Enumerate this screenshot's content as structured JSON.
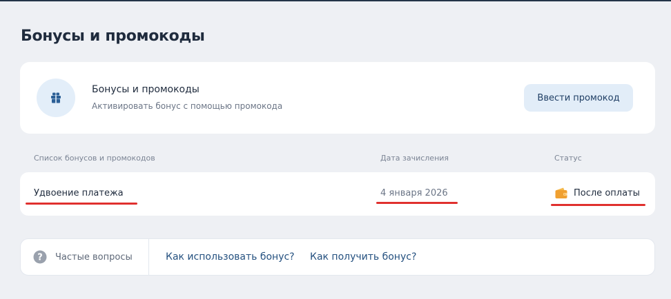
{
  "page": {
    "title": "Бонусы и промокоды"
  },
  "promo_card": {
    "title": "Бонусы и промокоды",
    "subtitle": "Активировать бонус с помощью промокода",
    "button_label": "Ввести промокод",
    "icon": "gift-icon"
  },
  "table": {
    "headers": {
      "name": "Список бонусов и промокодов",
      "date": "Дата зачисления",
      "status": "Статус"
    },
    "rows": [
      {
        "name": "Удвоение платежа",
        "date": "4 января 2026",
        "status": "После оплаты",
        "status_icon": "wallet-icon"
      }
    ]
  },
  "faq": {
    "label": "Частые вопросы",
    "icon": "question-icon",
    "links": [
      "Как использовать бонус?",
      "Как получить бонус?"
    ]
  },
  "colors": {
    "background": "#eef0f4",
    "accent_button": "#e2edf8",
    "link": "#24507f",
    "annotation_underline": "#e0302e",
    "wallet": "#f0a030"
  }
}
